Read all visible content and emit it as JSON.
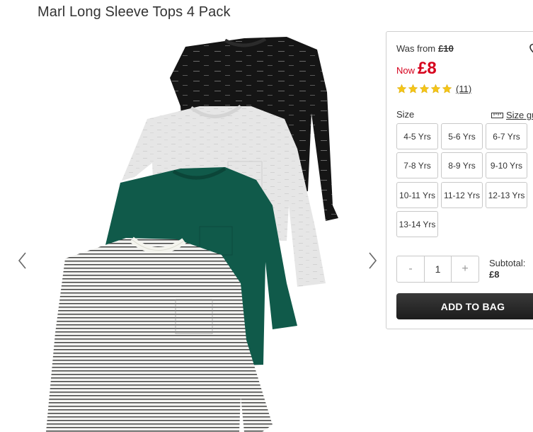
{
  "product": {
    "title": "Marl Long Sleeve Tops 4 Pack"
  },
  "price": {
    "was_label": "Was from",
    "was_value": "£10",
    "now_label": "Now",
    "now_value": "£8"
  },
  "rating": {
    "stars": 5,
    "review_count": "(11)"
  },
  "size": {
    "label": "Size",
    "guide_label": "Size gu",
    "options": [
      "4-5 Yrs",
      "5-6 Yrs",
      "6-7 Yrs",
      "7-8 Yrs",
      "8-9 Yrs",
      "9-10 Yrs",
      "10-11 Yrs",
      "11-12 Yrs",
      "12-13 Yrs",
      "13-14 Yrs"
    ]
  },
  "quantity": {
    "minus": "-",
    "value": "1",
    "plus": "+"
  },
  "subtotal": {
    "label": "Subtotal:",
    "value": "£8"
  },
  "actions": {
    "add_to_bag": "ADD TO BAG"
  },
  "colors": {
    "accent_red": "#d6001c",
    "star_yellow": "#f5c518",
    "button_dark": "#2a2a2a"
  },
  "icons": {
    "prev": "chevron-left-icon",
    "next": "chevron-right-icon",
    "wishlist": "heart-icon",
    "size_guide": "ruler-icon"
  }
}
